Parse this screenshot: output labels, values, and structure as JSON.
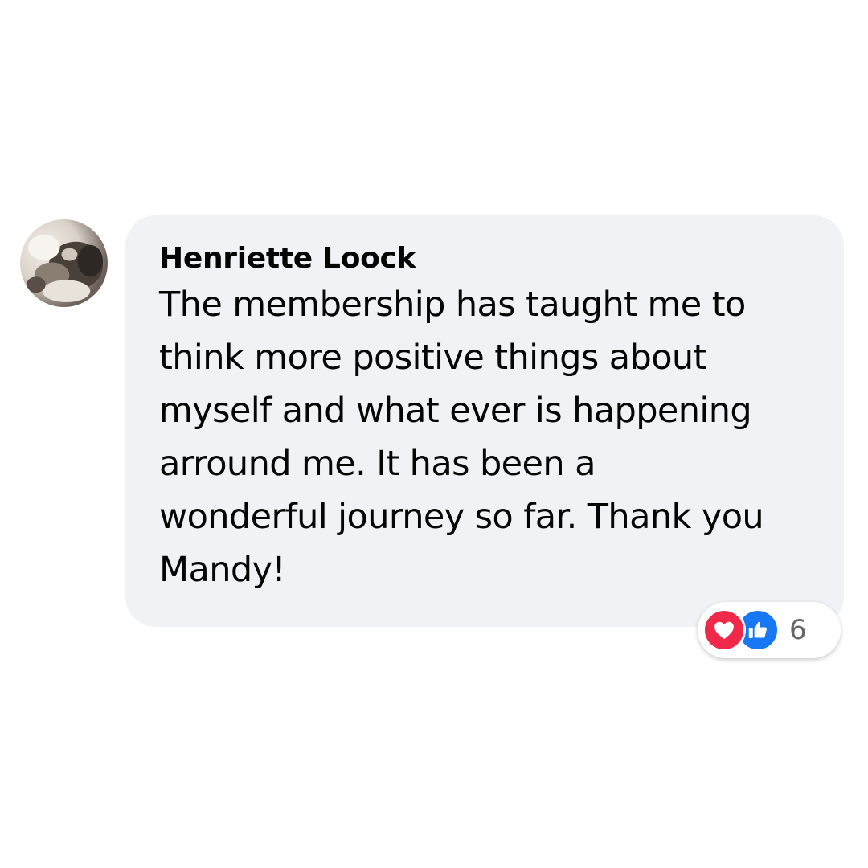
{
  "comment": {
    "author": "Henriette Loock",
    "text": "The membership has taught me to\nthink more positive things about\nmyself and what ever is happening\narround me. It has been a\nwonderful journey so far. Thank you\nMandy!",
    "reactions": {
      "icons": [
        "love-icon",
        "like-icon"
      ],
      "count": "6",
      "love_color": "#f02849",
      "like_color": "#1877f2"
    },
    "bubble_color": "#f0f2f5"
  }
}
